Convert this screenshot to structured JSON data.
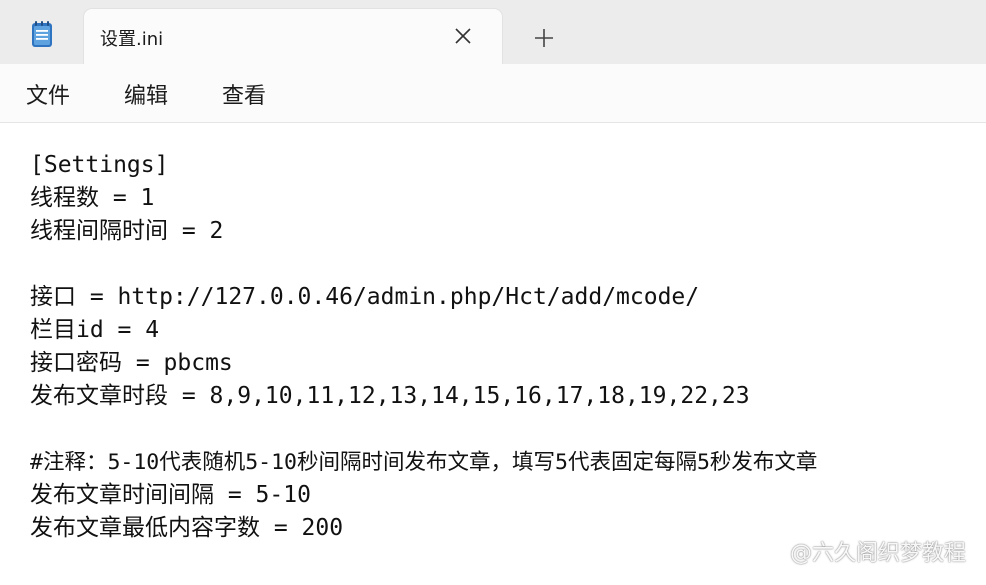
{
  "tab": {
    "title": "设置.ini",
    "icon": "notepad-icon",
    "close_icon": "close-icon",
    "new_tab_icon": "plus-icon"
  },
  "menu": {
    "items": [
      "文件",
      "编辑",
      "查看"
    ]
  },
  "editor": {
    "lines": [
      "[Settings]",
      "线程数 = 1",
      "线程间隔时间 = 2",
      "",
      "接口 = http://127.0.0.46/admin.php/Hct/add/mcode/",
      "栏目id = 4",
      "接口密码 = pbcms",
      "发布文章时段 = 8,9,10,11,12,13,14,15,16,17,18,19,22,23",
      "",
      "#注释：5-10代表随机5-10秒间隔时间发布文章，填写5代表固定每隔5秒发布文章",
      "发布文章时间间隔 = 5-10",
      "发布文章最低内容字数 = 200"
    ]
  },
  "watermark": {
    "text": "@六久阁织梦教程"
  },
  "colors": {
    "accent": "#3b82c4",
    "text": "#111111",
    "tabbar_bg": "#ececec"
  }
}
